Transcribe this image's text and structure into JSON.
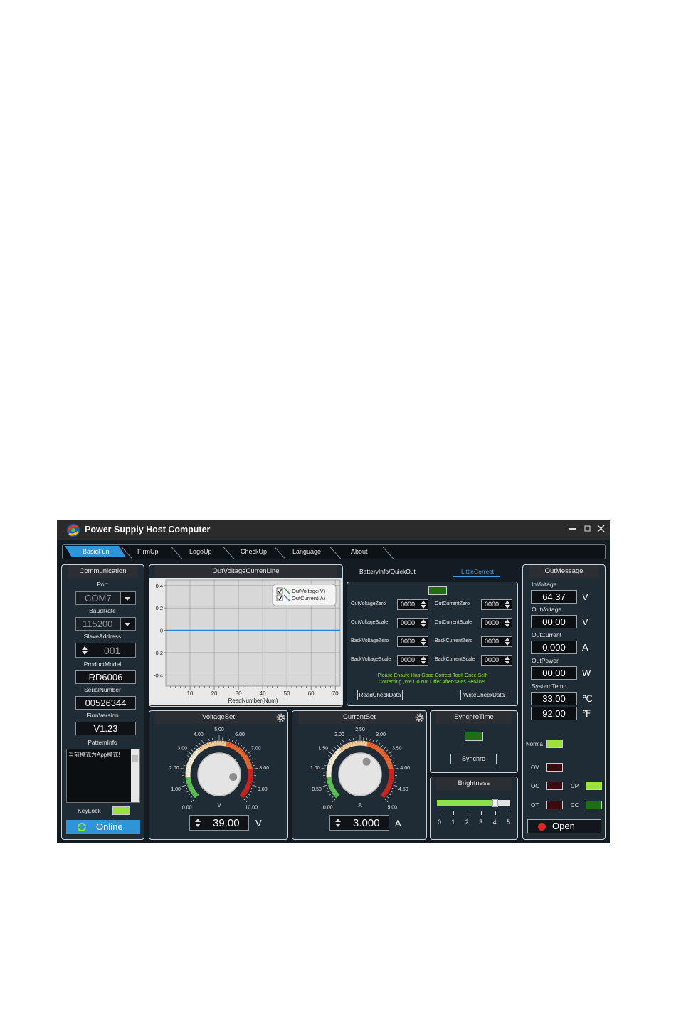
{
  "window": {
    "title": "Power Supply Host Computer",
    "controls": [
      "minimize-icon",
      "maximize-icon",
      "close-icon"
    ]
  },
  "nav": {
    "tabs": [
      "BasicFun",
      "FirmUp",
      "LogoUp",
      "CheckUp",
      "Language",
      "About"
    ],
    "active": "BasicFun"
  },
  "communication": {
    "title": "Communication",
    "port_label": "Port",
    "port_value": "COM7",
    "baud_label": "BaudRate",
    "baud_value": "115200",
    "slave_label": "SlaveAddress",
    "slave_value": "001",
    "model_label": "ProductModel",
    "model_value": "RD6006",
    "serial_label": "SerialNumber",
    "serial_value": "00526344",
    "firm_label": "FirmVersion",
    "firm_value": "V1.23",
    "pattern_label": "PatternInfo",
    "pattern_text": "当前模式为App模式!",
    "keylock_label": "KeyLock",
    "online_label": "Online"
  },
  "chart": {
    "title": "OutVoltageCurrenLine",
    "legend": [
      "OutVoltage(V)",
      "OutCurrent(A)"
    ],
    "xlabel": "ReadNumber(Num)"
  },
  "chart_data": {
    "type": "line",
    "title": "OutVoltageCurrenLine",
    "xlabel": "ReadNumber(Num)",
    "ylabel": "",
    "xlim": [
      0,
      72
    ],
    "ylim": [
      -0.5,
      0.45
    ],
    "xticks": [
      10,
      20,
      30,
      40,
      50,
      60,
      70
    ],
    "yticks": [
      0.4,
      0.2,
      0,
      -0.2,
      -0.4
    ],
    "ytick_labels": [
      "0.4",
      "0.2",
      "0",
      "-0.2",
      "-0.4"
    ],
    "grid": true,
    "legend_position": "top-right",
    "series": [
      {
        "name": "OutVoltage(V)",
        "x": [
          0,
          72
        ],
        "values": [
          0,
          0
        ],
        "color": "#2f7fd0"
      },
      {
        "name": "OutCurrent(A)",
        "x": [
          0,
          72
        ],
        "values": [
          0,
          0
        ],
        "color": "#2f7fd0"
      }
    ]
  },
  "calib": {
    "tab1": "BatteryInfo/QuickOut",
    "tab2": "LittleCorrect",
    "rows": [
      {
        "l1": "OutVoltageZero",
        "v1": "0000",
        "l2": "OutCurrentZero",
        "v2": "0000"
      },
      {
        "l1": "OutVoltageScale",
        "v1": "0000",
        "l2": "OutCurrentScale",
        "v2": "0000"
      },
      {
        "l1": "BackVoltageZero",
        "v1": "0000",
        "l2": "BackCurrentZero",
        "v2": "0000"
      },
      {
        "l1": "BackVoltageScale",
        "v1": "0000",
        "l2": "BackCurrentScale",
        "v2": "0000"
      }
    ],
    "warning1": "Please Ensure Has Good Correct Tool!  Once Self",
    "warning2": "Correcting ,We Do Not Offer After-sales Service!",
    "read_btn": "ReadCheckData",
    "write_btn": "WriteCheckData"
  },
  "voltage": {
    "title": "VoltageSet",
    "scale": [
      "0.00",
      "1.00",
      "2.00",
      "3.00",
      "4.00",
      "5.00",
      "6.00",
      "7.00",
      "8.00",
      "9.00",
      "10.00"
    ],
    "unit_letter": "V",
    "value": "39.00",
    "unit": "V",
    "knob_fraction": 0.87
  },
  "current": {
    "title": "CurrentSet",
    "scale": [
      "0.00",
      "0.50",
      "1.00",
      "1.50",
      "2.00",
      "2.50",
      "3.00",
      "3.50",
      "4.00",
      "4.50",
      "5.00"
    ],
    "unit_letter": "A",
    "value": "3.000",
    "unit": "A",
    "knob_fraction": 0.6
  },
  "synchro": {
    "title": "SynchroTime",
    "button": "Synchro"
  },
  "brightness": {
    "title": "Brightness",
    "ticks": [
      "0",
      "1",
      "2",
      "3",
      "4",
      "5"
    ],
    "level": 4
  },
  "out": {
    "title": "OutMessage",
    "items": [
      {
        "label": "InVoltage",
        "value": "64.37",
        "unit": "V"
      },
      {
        "label": "OutVoltage",
        "value": "00.00",
        "unit": "V"
      },
      {
        "label": "OutCurrent",
        "value": "0.000",
        "unit": "A"
      },
      {
        "label": "OutPower",
        "value": "00.00",
        "unit": "W"
      },
      {
        "label": "SystemTemp",
        "value": "33.00",
        "unit": "℃"
      },
      {
        "label": "",
        "value": "92.00",
        "unit": "℉"
      }
    ],
    "norma": "Norma",
    "ov": "OV",
    "oc": "OC",
    "ot": "OT",
    "cp": "CP",
    "cc": "CC",
    "open_label": "Open"
  },
  "colors": {
    "accent": "#2f95d6",
    "led_on": "#9be23a",
    "led_dark_green": "#1f6e16",
    "led_red": "#3b0b0f",
    "panel_bg": "#1f2b35"
  }
}
